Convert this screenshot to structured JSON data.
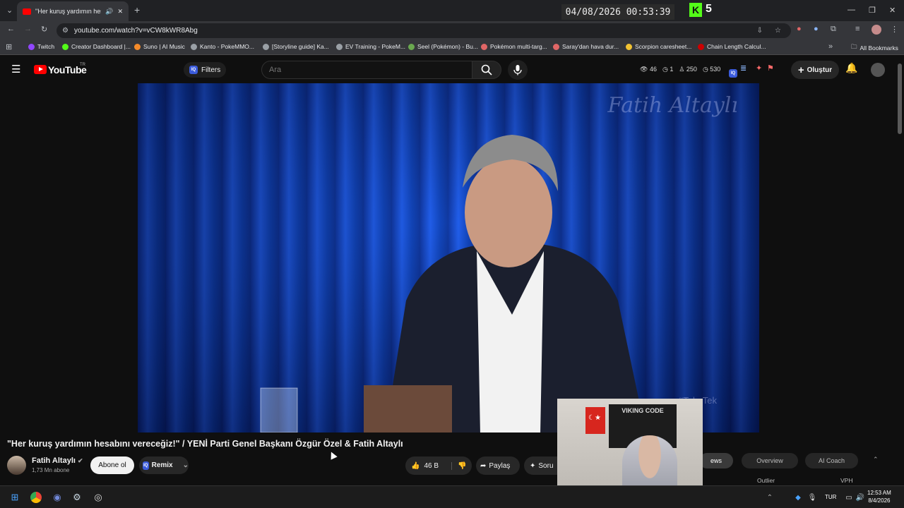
{
  "browser": {
    "tab_title": "\"Her kuruş yardımın hesab",
    "url": "youtube.com/watch?v=vCW8kWR8Abg",
    "overlay_datetime": "04/08/2026 00:53:39",
    "kick_count": "5",
    "bookmarks": [
      {
        "label": "Twitch",
        "color": "#9146ff"
      },
      {
        "label": "Creator Dashboard |...",
        "color": "#53fc18"
      },
      {
        "label": "Suno | AI Music",
        "color": "#f58b2a"
      },
      {
        "label": "Kanto - PokeMMO...",
        "color": "#9aa0a6"
      },
      {
        "label": "[Storyline guide] Ka...",
        "color": "#9aa0a6"
      },
      {
        "label": "EV Training - PokeM...",
        "color": "#9aa0a6"
      },
      {
        "label": "Seel (Pokémon) - Bu...",
        "color": "#6aa84f"
      },
      {
        "label": "Pokémon multi-targ...",
        "color": "#e06666"
      },
      {
        "label": "Saray'dan hava dur...",
        "color": "#e06666"
      },
      {
        "label": "Scorpion caresheet...",
        "color": "#f1c232"
      },
      {
        "label": "Chain Length Calcul...",
        "color": "#cc0000"
      }
    ],
    "all_bookmarks": "All Bookmarks"
  },
  "youtube": {
    "logo": "YouTube",
    "region": "TR",
    "filters_label": "Filters",
    "search_placeholder": "Ara",
    "stats": [
      "46",
      "1",
      "250",
      "530"
    ],
    "create_label": "Oluştur"
  },
  "video": {
    "watermark": "Fatih Altaylı",
    "watermark2": "#TakeTek",
    "title": "\"Her kuruş yardımın hesabını vereceğiz!\" / YENİ Parti Genel Başkanı Özgür Özel & Fatih Altaylı",
    "channel": "Fatih Altaylı",
    "subscribers": "1,73 Mn abone",
    "subscribe_label": "Abone ol",
    "remix_label": "Remix",
    "likes": "46 B",
    "share_label": "Paylaş",
    "ask_label": "Soru"
  },
  "side_panel": {
    "tabs": [
      "ews",
      "Overview",
      "AI Coach"
    ],
    "columns": [
      "t",
      "Outlier",
      "VPH"
    ]
  },
  "webcam": {
    "poster_text": "VIKING CODE"
  },
  "taskbar": {
    "lang": "TUR",
    "time": "12:53 AM",
    "date": "8/4/2026"
  }
}
